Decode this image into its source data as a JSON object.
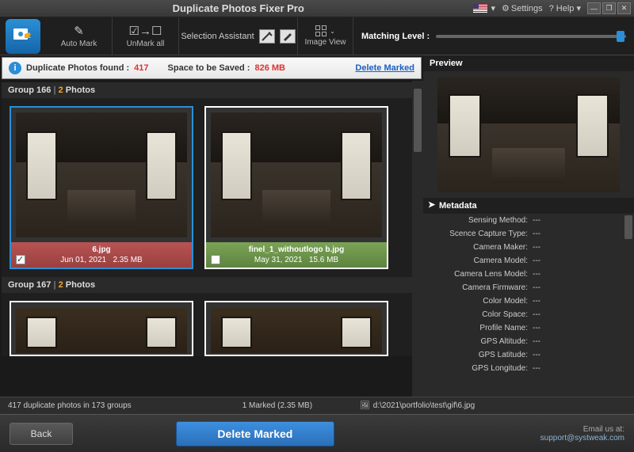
{
  "title": "Duplicate Photos Fixer Pro",
  "titlebar": {
    "settings": "Settings",
    "help": "? Help"
  },
  "toolbar": {
    "automark": "Auto Mark",
    "unmarkall": "UnMark all",
    "selection_assistant": "Selection Assistant",
    "image_view": "Image View",
    "matching_level": "Matching Level :"
  },
  "stats": {
    "found_label": "Duplicate Photos found :",
    "found_count": "417",
    "save_label": "Space to be Saved :",
    "save_value": "826 MB",
    "delete_marked": "Delete Marked"
  },
  "groups": [
    {
      "header_a": "Group 166",
      "header_b": "2",
      "header_c": "Photos",
      "cards": [
        {
          "filename": "6.jpg",
          "date": "Jun 01, 2021",
          "size": "2.35 MB"
        },
        {
          "filename": "finel_1_withoutlogo b.jpg",
          "date": "May 31, 2021",
          "size": "15.6 MB"
        }
      ]
    },
    {
      "header_a": "Group 167",
      "header_b": "2",
      "header_c": "Photos"
    }
  ],
  "preview": {
    "header": "Preview"
  },
  "metadata": {
    "header": "Metadata",
    "rows": [
      {
        "k": "Sensing Method:",
        "v": "---"
      },
      {
        "k": "Scence Capture Type:",
        "v": "---"
      },
      {
        "k": "Camera Maker:",
        "v": "---"
      },
      {
        "k": "Camera Model:",
        "v": "---"
      },
      {
        "k": "Camera Lens Model:",
        "v": "---"
      },
      {
        "k": "Camera Firmware:",
        "v": "---"
      },
      {
        "k": "Color Model:",
        "v": "---"
      },
      {
        "k": "Color Space:",
        "v": "---"
      },
      {
        "k": "Profile Name:",
        "v": "---"
      },
      {
        "k": "GPS Altitude:",
        "v": "---"
      },
      {
        "k": "GPS Latitude:",
        "v": "---"
      },
      {
        "k": "GPS Longitude:",
        "v": "---"
      }
    ]
  },
  "statusbar": {
    "summary": "417 duplicate photos in 173 groups",
    "marked": "1 Marked (2.35 MB)",
    "path": "d:\\2021\\portfolio\\test\\gif\\6.jpg"
  },
  "bottom": {
    "back": "Back",
    "delete": "Delete Marked",
    "email_label": "Email us at:",
    "email": "support@systweak.com"
  }
}
